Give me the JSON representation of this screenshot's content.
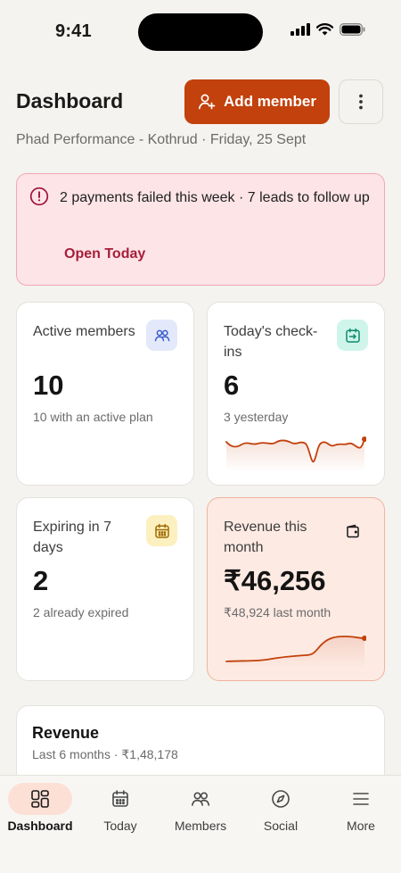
{
  "status": {
    "time": "9:41"
  },
  "header": {
    "title": "Dashboard",
    "add_label": "Add member",
    "subtitle": "Phad Performance - Kothrud · Friday, 25 Sept"
  },
  "alert": {
    "text": "2 payments failed this week · 7 leads to follow up",
    "link": "Open Today"
  },
  "stats": [
    {
      "label": "Active members",
      "value": "10",
      "sub": "10 with an active plan",
      "icon": "members-icon"
    },
    {
      "label": "Today's check-ins",
      "value": "6",
      "sub": "3 yesterday",
      "icon": "checkin-icon"
    },
    {
      "label": "Expiring in 7 days",
      "value": "2",
      "sub": "2 already expired",
      "icon": "calendar-icon"
    },
    {
      "label": "Revenue this month",
      "value": "₹46,256",
      "sub": "₹48,924 last month",
      "icon": "wallet-icon"
    }
  ],
  "revenue": {
    "title": "Revenue",
    "sub": "Last 6 months · ₹1,48,178"
  },
  "tabs": [
    {
      "label": "Dashboard",
      "icon": "dashboard-icon",
      "active": true
    },
    {
      "label": "Today",
      "icon": "calendar-icon"
    },
    {
      "label": "Members",
      "icon": "members-icon"
    },
    {
      "label": "Social",
      "icon": "compass-icon"
    },
    {
      "label": "More",
      "icon": "menu-icon"
    }
  ],
  "colors": {
    "accent": "#c2410c",
    "alert_bg": "#fde4e7",
    "alert_text": "#a61e3a",
    "background": "#f4f3ef"
  }
}
